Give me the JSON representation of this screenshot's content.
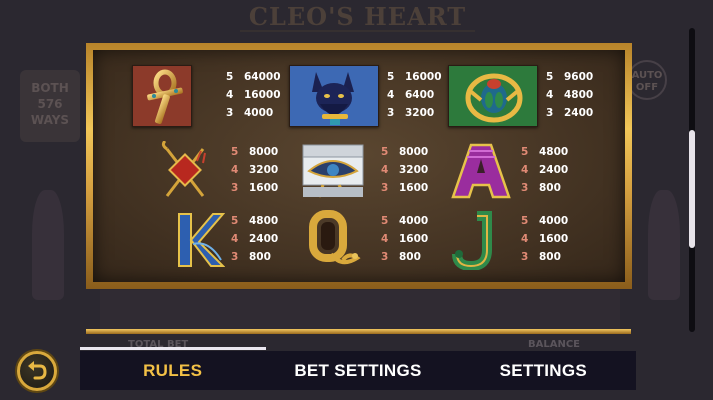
{
  "background": {
    "logo": "CLEO'S HEART",
    "ways_label": "BOTH 576 WAYS",
    "auto_label": "AUTO OFF",
    "total_bet_label": "TOTAL BET",
    "balance_label": "BALANCE"
  },
  "paytable": {
    "rows": [
      [
        {
          "symbol": "ankh-symbol",
          "tile_color": "#8c3a2a",
          "pays": [
            {
              "count": "5",
              "value": "64000"
            },
            {
              "count": "4",
              "value": "16000"
            },
            {
              "count": "3",
              "value": "4000"
            }
          ]
        },
        {
          "symbol": "cat-bastet-symbol",
          "tile_color": "#3d69b4",
          "pays": [
            {
              "count": "5",
              "value": "16000"
            },
            {
              "count": "4",
              "value": "6400"
            },
            {
              "count": "3",
              "value": "3200"
            }
          ]
        },
        {
          "symbol": "scarab-symbol",
          "tile_color": "#2d7a3c",
          "pays": [
            {
              "count": "5",
              "value": "9600"
            },
            {
              "count": "4",
              "value": "4800"
            },
            {
              "count": "3",
              "value": "2400"
            }
          ]
        }
      ],
      [
        {
          "symbol": "crook-flail-symbol",
          "pays": [
            {
              "count": "5",
              "value": "8000"
            },
            {
              "count": "4",
              "value": "3200"
            },
            {
              "count": "3",
              "value": "1600"
            }
          ]
        },
        {
          "symbol": "eye-of-horus-symbol",
          "pays": [
            {
              "count": "5",
              "value": "8000"
            },
            {
              "count": "4",
              "value": "3200"
            },
            {
              "count": "3",
              "value": "1600"
            }
          ]
        },
        {
          "symbol": "letter-a-symbol",
          "pays": [
            {
              "count": "5",
              "value": "4800"
            },
            {
              "count": "4",
              "value": "2400"
            },
            {
              "count": "3",
              "value": "800"
            }
          ]
        }
      ],
      [
        {
          "symbol": "letter-k-symbol",
          "pays": [
            {
              "count": "5",
              "value": "4800"
            },
            {
              "count": "4",
              "value": "2400"
            },
            {
              "count": "3",
              "value": "800"
            }
          ]
        },
        {
          "symbol": "letter-q-symbol",
          "pays": [
            {
              "count": "5",
              "value": "4000"
            },
            {
              "count": "4",
              "value": "1600"
            },
            {
              "count": "3",
              "value": "800"
            }
          ]
        },
        {
          "symbol": "letter-j-symbol",
          "pays": [
            {
              "count": "5",
              "value": "4000"
            },
            {
              "count": "4",
              "value": "1600"
            },
            {
              "count": "3",
              "value": "800"
            }
          ]
        }
      ]
    ]
  },
  "nav": {
    "tabs": [
      "RULES",
      "BET SETTINGS",
      "SETTINGS"
    ],
    "active_tab": "RULES",
    "active_color": "#f3c146"
  },
  "icons": {
    "back": "back-arrow-icon"
  }
}
